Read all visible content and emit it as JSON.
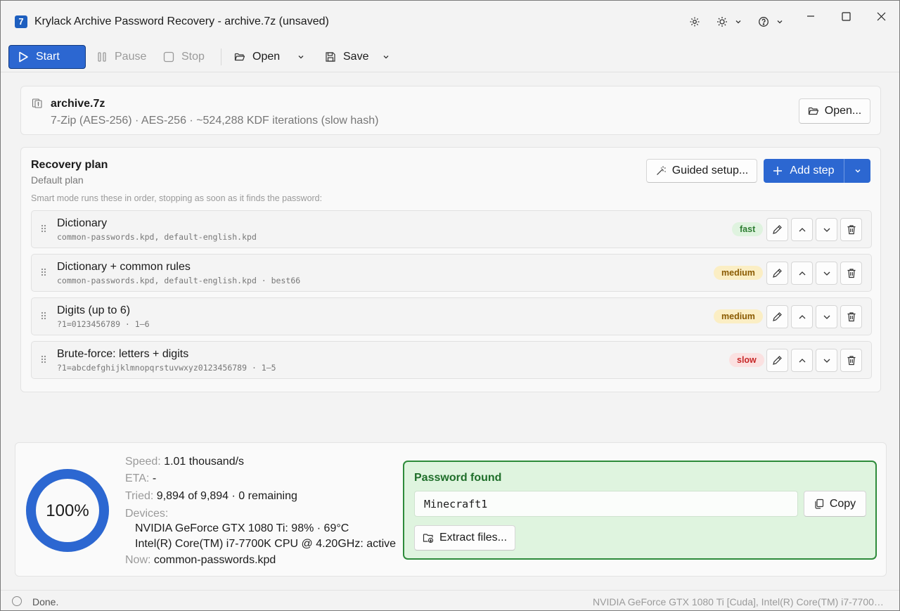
{
  "app": {
    "icon_glyph": "7",
    "title": "Krylack Archive Password Recovery - archive.7z (unsaved)"
  },
  "toolbar": {
    "start_label": "Start",
    "pause_label": "Pause",
    "stop_label": "Stop",
    "open_label": "Open",
    "save_label": "Save"
  },
  "archive": {
    "name": "archive.7z",
    "description": "7-Zip (AES-256) · AES-256 · ~524,288 KDF iterations (slow hash)",
    "open_label": "Open..."
  },
  "plan": {
    "title": "Recovery plan",
    "subtitle": "Default plan",
    "hint": "Smart mode runs these in order, stopping as soon as it finds the password:",
    "guided_label": "Guided setup...",
    "add_label": "Add step",
    "steps": [
      {
        "name": "Dictionary",
        "detail": "common-passwords.kpd, default-english.kpd",
        "speed": "fast"
      },
      {
        "name": "Dictionary + common rules",
        "detail": "common-passwords.kpd, default-english.kpd · best66",
        "speed": "medium"
      },
      {
        "name": "Digits (up to 6)",
        "detail": "?1=0123456789 · 1–6",
        "speed": "medium"
      },
      {
        "name": "Brute-force: letters + digits",
        "detail": "?1=abcdefghijklmnopqrstuvwxyz0123456789 · 1–5",
        "speed": "slow"
      }
    ]
  },
  "progress": {
    "percent_text": "100%",
    "percent_value": 100,
    "speed_label": "Speed:",
    "speed_value": "1.01 thousand/s",
    "eta_label": "ETA:",
    "eta_value": "-",
    "tried_label": "Tried:",
    "tried_value": "9,894 of 9,894 · 0 remaining",
    "devices_label": "Devices:",
    "devices": [
      "NVIDIA GeForce GTX 1080 Ti: 98% · 69°C",
      "Intel(R) Core(TM) i7-7700K CPU @ 4.20GHz: active"
    ],
    "now_label": "Now:",
    "now_value": "common-passwords.kpd"
  },
  "found": {
    "title": "Password found",
    "password": "Minecraft1",
    "copy_label": "Copy",
    "extract_label": "Extract files..."
  },
  "status": {
    "text": "Done.",
    "devices": "NVIDIA GeForce GTX 1080 Ti [Cuda], Intel(R) Core(TM) i7-7700K C..."
  },
  "colors": {
    "accent": "#2c67d1",
    "success_border": "#2e8b3b",
    "success_bg": "#dff4df"
  }
}
